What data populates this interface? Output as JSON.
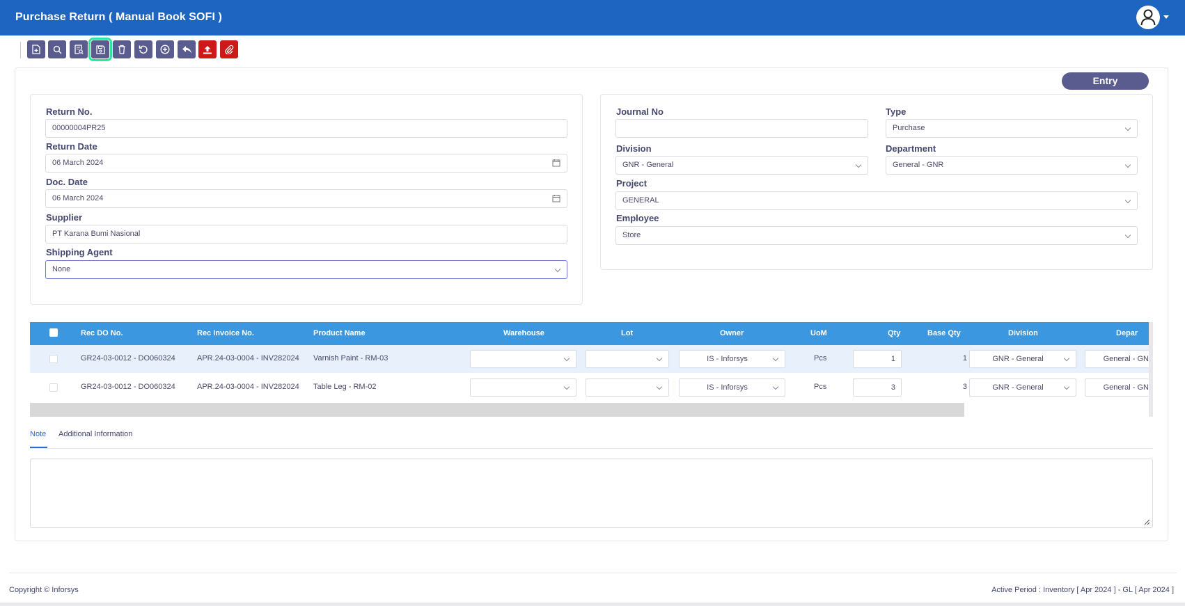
{
  "app": {
    "title": "Purchase Return ( Manual Book SOFI )"
  },
  "status": {
    "label": "Entry"
  },
  "form": {
    "return_no": {
      "label": "Return No.",
      "value": "00000004PR25"
    },
    "return_date": {
      "label": "Return Date",
      "value": "06 March 2024"
    },
    "doc_date": {
      "label": "Doc. Date",
      "value": "06 March 2024"
    },
    "supplier": {
      "label": "Supplier",
      "value": "PT Karana Bumi Nasional"
    },
    "shipping_agent": {
      "label": "Shipping Agent",
      "value": "None"
    },
    "journal_no": {
      "label": "Journal No",
      "value": ""
    },
    "type": {
      "label": "Type",
      "value": "Purchase"
    },
    "division": {
      "label": "Division",
      "value": "GNR - General"
    },
    "department": {
      "label": "Department",
      "value": "General - GNR"
    },
    "project": {
      "label": "Project",
      "value": "GENERAL"
    },
    "employee": {
      "label": "Employee",
      "value": "Store"
    }
  },
  "grid": {
    "columns": [
      "Rec DO No.",
      "Rec Invoice No.",
      "Product Name",
      "Warehouse",
      "Lot",
      "Owner",
      "UoM",
      "Qty",
      "Base Qty",
      "Division",
      "Depar"
    ],
    "rows": [
      {
        "rec_do": "GR24-03-0012 - DO060324",
        "rec_invoice": "APR.24-03-0004 - INV282024",
        "product": "Varnish Paint - RM-03",
        "warehouse": "",
        "lot": "",
        "owner": "IS - Inforsys",
        "uom": "Pcs",
        "qty": "1",
        "base_qty": "1",
        "division": "GNR - General",
        "department": "General - GN"
      },
      {
        "rec_do": "GR24-03-0012 - DO060324",
        "rec_invoice": "APR.24-03-0004 - INV282024",
        "product": "Table Leg - RM-02",
        "warehouse": "",
        "lot": "",
        "owner": "IS - Inforsys",
        "uom": "Pcs",
        "qty": "3",
        "base_qty": "3",
        "division": "GNR - General",
        "department": "General - GN"
      }
    ]
  },
  "tabs": {
    "note": "Note",
    "additional": "Additional Information"
  },
  "note": {
    "value": ""
  },
  "footer": {
    "copyright": "Copyright © Inforsys",
    "period": "Active Period : Inventory [ Apr 2024 ] - GL [ Apr 2024 ]"
  },
  "colors": {
    "header": "#1d65c1",
    "toolbar_button": "#5a5b8f",
    "toolbar_red": "#cc1a1a",
    "grid_header": "#3b97e0",
    "active_outline": "#2ee59d"
  },
  "toolbar_icons": [
    "new-document-icon",
    "search-icon",
    "preview-icon",
    "save-icon",
    "delete-icon",
    "refresh-icon",
    "add-icon",
    "undo-icon",
    "upload-icon",
    "attachment-icon"
  ]
}
